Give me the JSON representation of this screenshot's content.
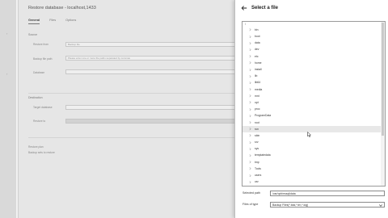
{
  "background_dialog": {
    "title": "Restore database - localhost,1433",
    "tabs": [
      {
        "label": "General"
      },
      {
        "label": "Files"
      },
      {
        "label": "Options"
      }
    ],
    "sections": {
      "source": "Source",
      "destination": "Destination"
    },
    "fields": [
      {
        "label": "Restore from",
        "value": "Backup file"
      },
      {
        "label": "Backup file path",
        "value": "Please enter one or more file paths separated by commas"
      },
      {
        "label": "Database",
        "value": ""
      }
    ],
    "destination_fields": [
      {
        "label": "Target database",
        "value": ""
      },
      {
        "label": "Restore to",
        "value": ""
      }
    ],
    "restore_plan": {
      "heading": "Restore plan",
      "text": "Backup sets to restore"
    }
  },
  "file_picker": {
    "title": "Select a file",
    "root": "/",
    "items": [
      {
        "label": "bin"
      },
      {
        "label": "boot"
      },
      {
        "label": "data"
      },
      {
        "label": "dev"
      },
      {
        "label": "etc"
      },
      {
        "label": "home"
      },
      {
        "label": "install"
      },
      {
        "label": "lib"
      },
      {
        "label": "lib64"
      },
      {
        "label": "media"
      },
      {
        "label": "mnt"
      },
      {
        "label": "opt"
      },
      {
        "label": "proc"
      },
      {
        "label": "ProgramData"
      },
      {
        "label": "root"
      },
      {
        "label": "run"
      },
      {
        "label": "sbin"
      },
      {
        "label": "srv"
      },
      {
        "label": "sys"
      },
      {
        "label": "templatedata"
      },
      {
        "label": "tmp"
      },
      {
        "label": "Tools"
      },
      {
        "label": "users"
      },
      {
        "label": "usr"
      }
    ],
    "hovered_item": "run",
    "selected_path_label": "Selected path",
    "selected_path_value": "/var/opt/mssql/data",
    "files_of_type_label": "Files of type",
    "files_of_type_value": "Backup Files(*.bak,*.trn,*.log)"
  },
  "colors": {
    "hover_row": "#e8e8e8",
    "dim_background": "#e6e6e6"
  }
}
